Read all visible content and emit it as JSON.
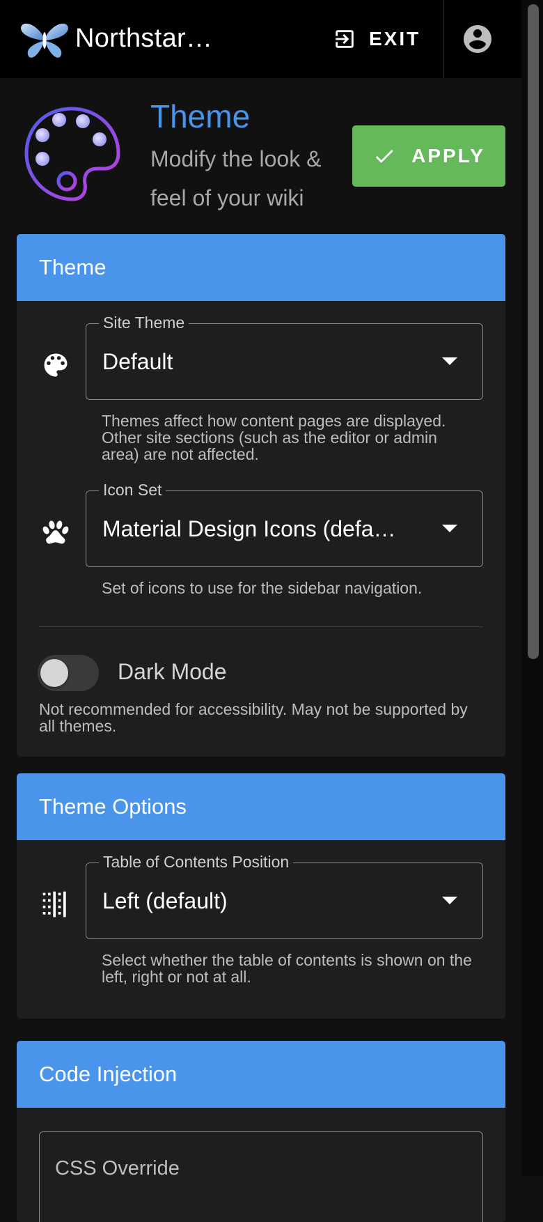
{
  "appbar": {
    "title": "Northstar…",
    "exit_label": "EXIT"
  },
  "page": {
    "title": "Theme",
    "subtitle": "Modify the look & feel of your wiki",
    "apply_label": "APPLY"
  },
  "colors": {
    "accent": "#4a94ec",
    "apply_button": "#66b95a",
    "card_bg": "#1e1e1e",
    "page_bg": "#111111"
  },
  "theme_card": {
    "title": "Theme",
    "site_theme": {
      "label": "Site Theme",
      "value": "Default",
      "icon": "palette-icon",
      "hint": "Themes affect how content pages are displayed. Other site sections (such as the editor or admin area) are not affected."
    },
    "icon_set": {
      "label": "Icon Set",
      "value": "Material Design Icons (defa…",
      "icon": "paw-icon",
      "hint": "Set of icons to use for the sidebar navigation."
    },
    "dark_mode": {
      "label": "Dark Mode",
      "enabled": false,
      "hint": "Not recommended for accessibility. May not be supported by all themes."
    }
  },
  "options_card": {
    "title": "Theme Options",
    "toc_position": {
      "label": "Table of Contents Position",
      "value": "Left (default)",
      "icon": "table-of-contents-icon",
      "hint": "Select whether the table of contents is shown on the left, right or not at all."
    }
  },
  "injection_card": {
    "title": "Code Injection",
    "css_override_label": "CSS Override"
  }
}
